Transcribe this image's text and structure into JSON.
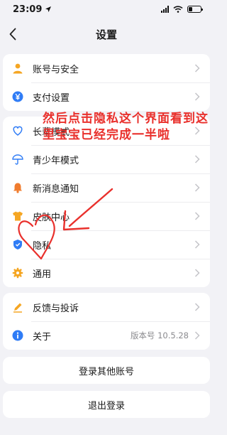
{
  "status": {
    "time": "23:09"
  },
  "nav": {
    "title": "设置"
  },
  "groups": [
    {
      "items": [
        {
          "label": "账号与安全",
          "icon": "person-icon",
          "color": "#f5a623"
        },
        {
          "label": "支付设置",
          "icon": "yen-circle-icon",
          "color": "#2f7cf6"
        }
      ]
    },
    {
      "items": [
        {
          "label": "长辈模式",
          "icon": "heart-outline-icon",
          "color": "#2f7cf6"
        },
        {
          "label": "青少年模式",
          "icon": "umbrella-icon",
          "color": "#2f7cf6"
        },
        {
          "label": "新消息通知",
          "icon": "bell-icon",
          "color": "#f07c2e"
        },
        {
          "label": "皮肤中心",
          "icon": "shirt-icon",
          "color": "#f5a623"
        },
        {
          "label": "隐私",
          "icon": "shield-icon",
          "color": "#2f7cf6"
        },
        {
          "label": "通用",
          "icon": "gear-icon",
          "color": "#f5a623"
        }
      ]
    },
    {
      "items": [
        {
          "label": "反馈与投诉",
          "icon": "pencil-icon",
          "color": "#f5a623"
        },
        {
          "label": "关于",
          "icon": "info-icon",
          "color": "#2f7cf6",
          "value": "版本号 10.5.28"
        }
      ]
    }
  ],
  "buttons": {
    "switch_account": "登录其他账号",
    "logout": "退出登录"
  },
  "annotation": {
    "text": "然后点击隐私这个界面看到这里宝宝已经完成一半啦",
    "color": "#e9302c"
  }
}
